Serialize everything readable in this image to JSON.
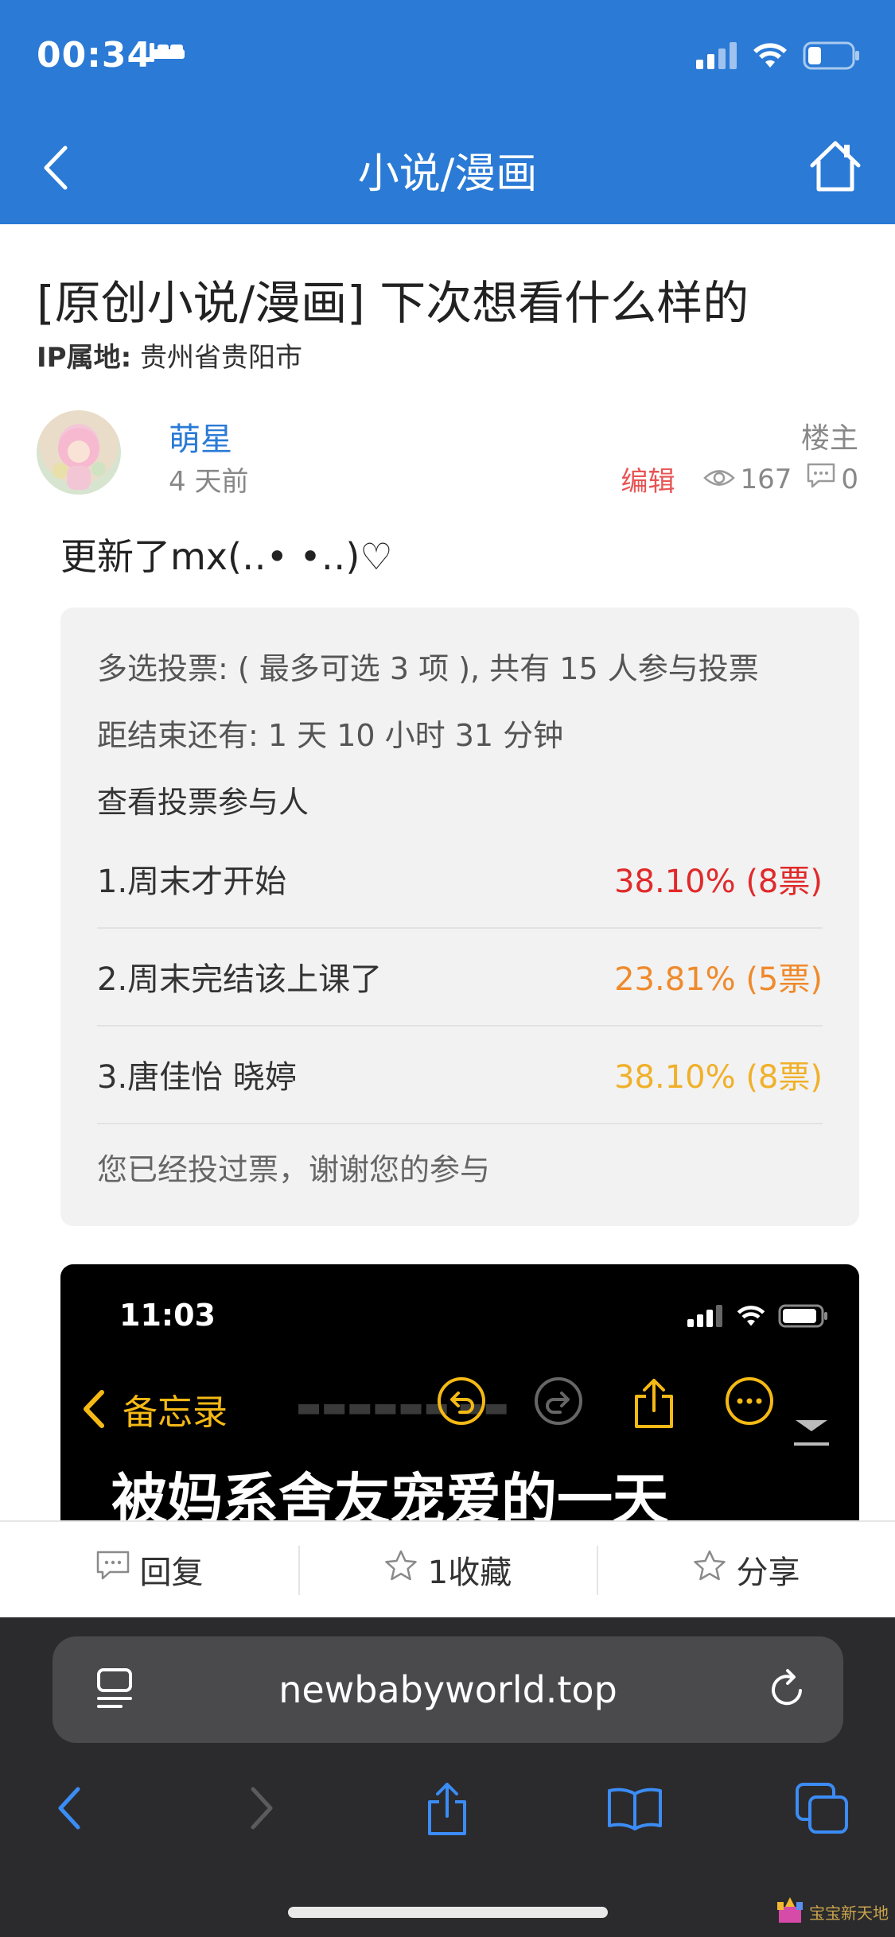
{
  "status_bar": {
    "time": "00:34",
    "battery_level": 0.3
  },
  "nav": {
    "title": "小说/漫画"
  },
  "post": {
    "title": "[原创小说/漫画] 下次想看什么样的",
    "ip_label": "IP属地:",
    "ip_location": "贵州省贵阳市",
    "author": "萌星",
    "time_ago": "4 天前",
    "role": "楼主",
    "edit_label": "编辑",
    "views": "167",
    "comments": "0",
    "body": "更新了mx(․․• •․․)♡"
  },
  "poll": {
    "summary": "多选投票: ( 最多可选 3 项 ), 共有 15 人参与投票",
    "time_left": "距结束还有: 1 天 10 小时 31 分钟",
    "view_voters": "查看投票参与人",
    "options": [
      {
        "label": "1.周末才开始",
        "result": "38.10% (8票)",
        "color": "#e02a2a"
      },
      {
        "label": "2.周末完结该上课了",
        "result": "23.81% (5票)",
        "color": "#ef8a2c"
      },
      {
        "label": "3.唐佳怡 晓婷",
        "result": "38.10% (8票)",
        "color": "#f0b02a"
      }
    ],
    "voted_note": "您已经投过票，谢谢您的参与"
  },
  "embedded_screenshot": {
    "time": "11:03",
    "back_label": "备忘录",
    "heading": "被妈系舍友宠爱的一天"
  },
  "actions": {
    "reply": "回复",
    "favorite": "1收藏",
    "share": "分享"
  },
  "browser": {
    "url": "newbabyworld.top"
  },
  "watermark": "宝宝新天地"
}
